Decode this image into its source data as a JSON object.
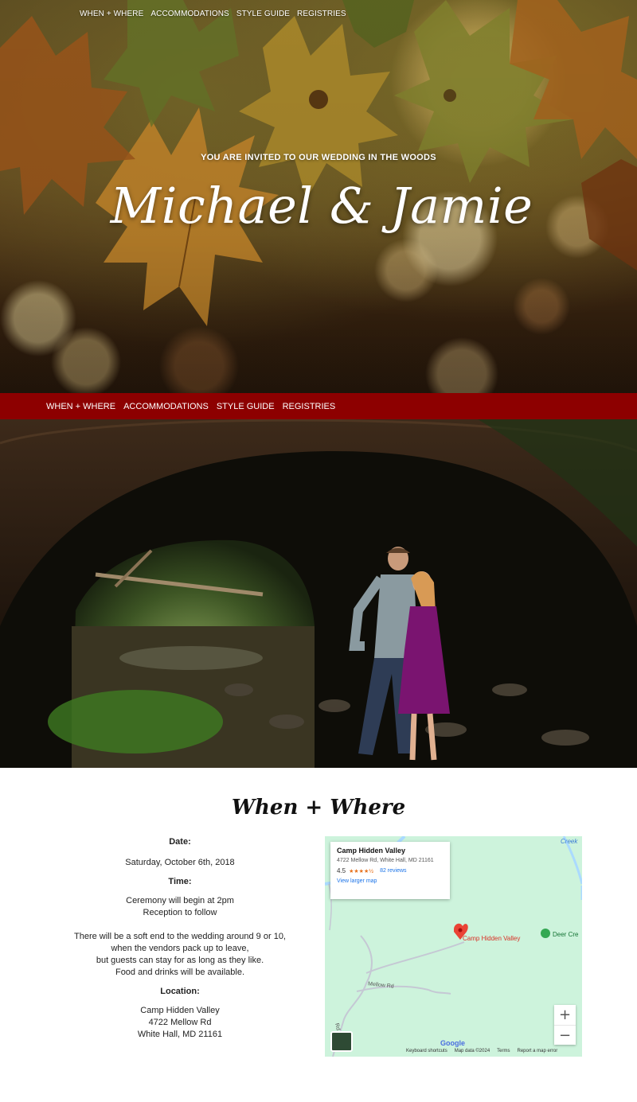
{
  "top_nav": [
    "WHEN + WHERE",
    "ACCOMMODATIONS",
    "STYLE GUIDE",
    "REGISTRIES"
  ],
  "hero": {
    "invite": "YOU ARE INVITED TO OUR WEDDING IN THE WOODS",
    "title": "Michael & Jamie"
  },
  "main_nav": [
    "WHEN + WHERE",
    "ACCOMMODATIONS",
    "STYLE GUIDE",
    "REGISTRIES"
  ],
  "when_where": {
    "heading": "When + Where",
    "date_label": "Date:",
    "date_value": "Saturday, October 6th, 2018",
    "time_label": "Time:",
    "time_lines": [
      "Ceremony will begin at 2pm",
      "Reception to follow"
    ],
    "note_lines": [
      "There will be a soft end to the wedding around 9 or 10,",
      "when the vendors pack up to leave,",
      "but guests can stay for as long as they like.",
      "Food and drinks will be available."
    ],
    "location_label": "Location:",
    "location_lines": [
      "Camp Hidden Valley",
      "4722 Mellow Rd",
      "White Hall, MD 21161"
    ]
  },
  "map": {
    "card_name": "Camp Hidden Valley",
    "card_address": "4722 Mellow Rd, White Hall, MD 21161",
    "rating": "4.5",
    "stars": "★★★★½",
    "reviews": "82 reviews",
    "larger_map": "View larger map",
    "pin_label": "Camp Hidden Valley",
    "poi_label": "Deer Cre",
    "road_label": "Mellow Rd",
    "road_label_2": "Rd",
    "creek_label": "Creek",
    "zoom_in": "+",
    "zoom_out": "−",
    "brand": "Google",
    "footer": [
      "Keyboard shortcuts",
      "Map data ©2024",
      "Terms",
      "Report a map error"
    ]
  },
  "colors": {
    "nav_bar": "#8d0000",
    "map_land": "#cdf3dc",
    "map_water": "#aadaff",
    "pin": "#ea4335"
  }
}
